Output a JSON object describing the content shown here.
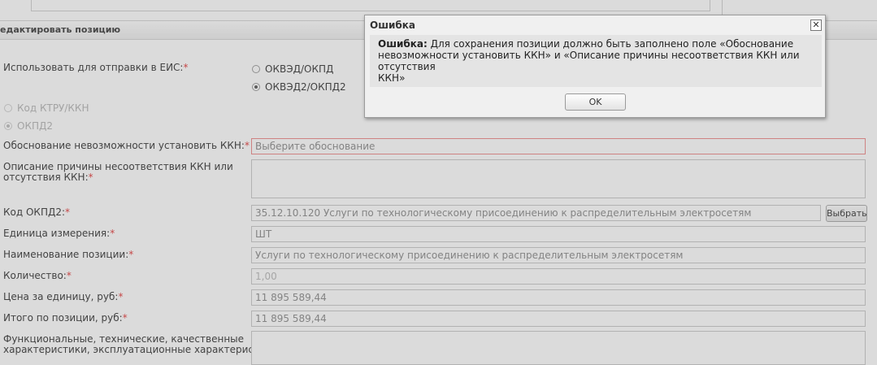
{
  "section": {
    "title": "едактировать позицию"
  },
  "form": {
    "eis": {
      "label": "Использовать для отправки в ЕИС:",
      "options": [
        "ОКВЭД/ОКПД",
        "ОКВЭД2/ОКПД2"
      ],
      "selected": "ОКВЭД2/ОКПД2"
    },
    "code_type": {
      "options": [
        "Код КТРУ/ККН",
        "ОКПД2"
      ],
      "selected": "ОКПД2"
    },
    "kkn_reason": {
      "label": "Обоснование невозможности установить ККН:",
      "placeholder": "Выберите обоснование",
      "value": ""
    },
    "kkn_mismatch": {
      "label_line1": "Описание причины несоответствия ККН или",
      "label_line2": "отсутствия ККН:",
      "value": ""
    },
    "okpd2": {
      "label": "Код ОКПД2:",
      "value": "35.12.10.120 Услуги по технологическому присоединению к распределительным электросетям",
      "button": "Выбрать"
    },
    "unit": {
      "label": "Единица измерения:",
      "value": "ШТ"
    },
    "name": {
      "label": "Наименование позиции:",
      "value": "Услуги по технологическому присоединению к распределительным электросетям"
    },
    "quantity": {
      "label": "Количество:",
      "value": "1,00"
    },
    "unit_price": {
      "label": "Цена за единицу, руб:",
      "value": "11 895 589,44"
    },
    "total": {
      "label": "Итого по позиции, руб:",
      "value": "11 895 589,44"
    },
    "characteristics": {
      "label_line1": "Функциональные, технические, качественные",
      "label_line2": "характеристики, эксплуатационные характеристики:",
      "value": ""
    },
    "required_mark": "*"
  },
  "dialog": {
    "title": "Ошибка",
    "close_glyph": "✕",
    "message_bold": "Ошибка:",
    "message_line1": "Для сохранения позиции должно быть заполнено поле «Обоснование",
    "message_line2": "невозможности установить ККН» и «Описание причины несоответствия ККН или отсутствия",
    "message_line3": "ККН»",
    "ok_label": "OK"
  },
  "colors": {
    "required": "#e23a3a",
    "error_border": "#e88888"
  }
}
